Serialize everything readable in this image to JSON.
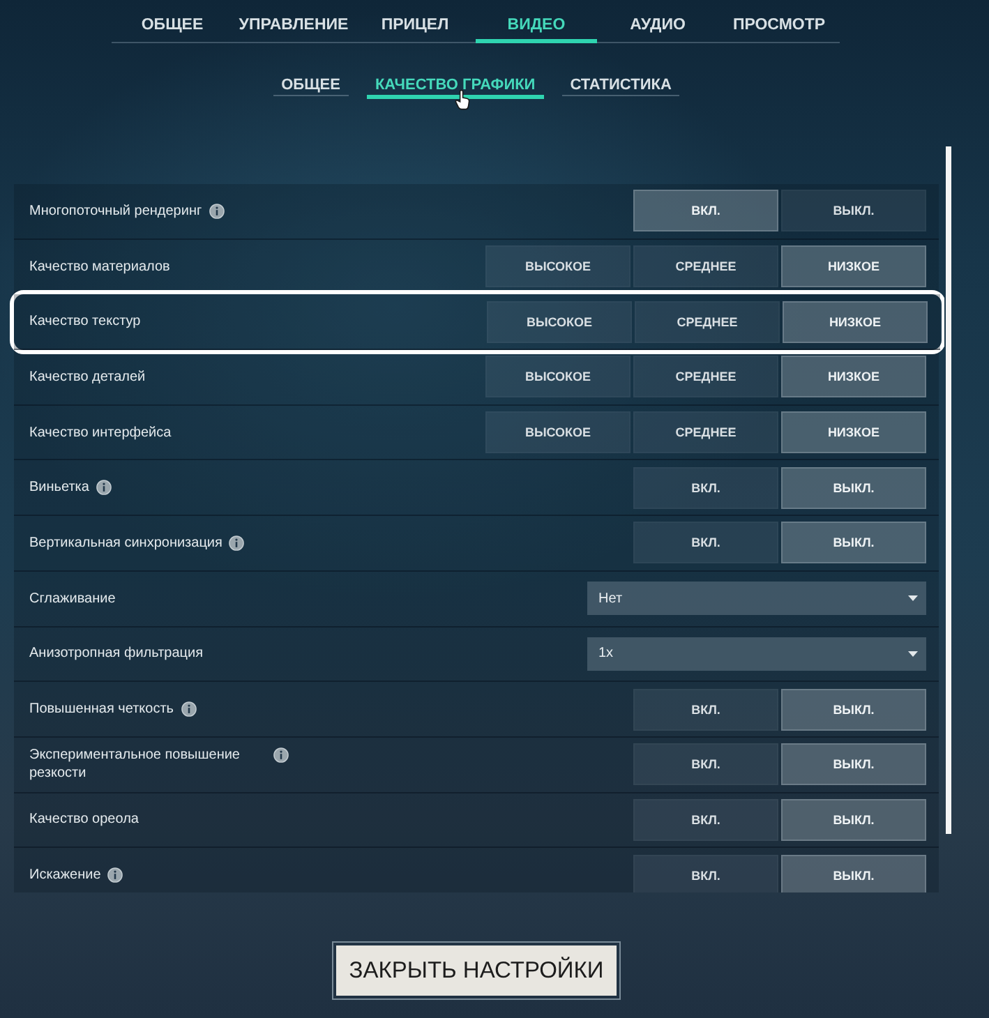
{
  "tabs": [
    {
      "label": "ОБЩЕЕ",
      "selected": false
    },
    {
      "label": "УПРАВЛЕНИЕ",
      "selected": false
    },
    {
      "label": "ПРИЦЕЛ",
      "selected": false
    },
    {
      "label": "ВИДЕО",
      "selected": true
    },
    {
      "label": "АУДИО",
      "selected": false
    },
    {
      "label": "ПРОСМОТР",
      "selected": false
    }
  ],
  "subtabs": [
    {
      "label": "ОБЩЕЕ",
      "selected": false
    },
    {
      "label": "КАЧЕСТВО ГРАФИКИ",
      "selected": true
    },
    {
      "label": "СТАТИСТИКА",
      "selected": false
    }
  ],
  "settings": [
    {
      "kind": "buttons",
      "label": "Многопоточный рендеринг",
      "info": true,
      "highlighted": false,
      "options": [
        {
          "label": "ВКЛ.",
          "selected": true
        },
        {
          "label": "ВЫКЛ.",
          "selected": false
        }
      ]
    },
    {
      "kind": "buttons",
      "label": "Качество материалов",
      "info": false,
      "highlighted": false,
      "options": [
        {
          "label": "ВЫСОКОЕ",
          "selected": false
        },
        {
          "label": "СРЕДНЕЕ",
          "selected": false
        },
        {
          "label": "НИЗКОЕ",
          "selected": true
        }
      ]
    },
    {
      "kind": "buttons",
      "label": "Качество текстур",
      "info": false,
      "highlighted": true,
      "options": [
        {
          "label": "ВЫСОКОЕ",
          "selected": false
        },
        {
          "label": "СРЕДНЕЕ",
          "selected": false
        },
        {
          "label": "НИЗКОЕ",
          "selected": true
        }
      ]
    },
    {
      "kind": "buttons",
      "label": "Качество деталей",
      "info": false,
      "highlighted": false,
      "options": [
        {
          "label": "ВЫСОКОЕ",
          "selected": false
        },
        {
          "label": "СРЕДНЕЕ",
          "selected": false
        },
        {
          "label": "НИЗКОЕ",
          "selected": true
        }
      ]
    },
    {
      "kind": "buttons",
      "label": "Качество интерфейса",
      "info": false,
      "highlighted": false,
      "options": [
        {
          "label": "ВЫСОКОЕ",
          "selected": false
        },
        {
          "label": "СРЕДНЕЕ",
          "selected": false
        },
        {
          "label": "НИЗКОЕ",
          "selected": true
        }
      ]
    },
    {
      "kind": "buttons",
      "label": "Виньетка",
      "info": true,
      "highlighted": false,
      "options": [
        {
          "label": "ВКЛ.",
          "selected": false
        },
        {
          "label": "ВЫКЛ.",
          "selected": true
        }
      ]
    },
    {
      "kind": "buttons",
      "label": "Вертикальная синхронизация",
      "info": true,
      "highlighted": false,
      "options": [
        {
          "label": "ВКЛ.",
          "selected": false
        },
        {
          "label": "ВЫКЛ.",
          "selected": true
        }
      ]
    },
    {
      "kind": "dropdown",
      "label": "Сглаживание",
      "info": false,
      "highlighted": false,
      "value": "Нет"
    },
    {
      "kind": "dropdown",
      "label": "Анизотропная фильтрация",
      "info": false,
      "highlighted": false,
      "value": "1x"
    },
    {
      "kind": "buttons",
      "label": "Повышенная четкость",
      "info": true,
      "highlighted": false,
      "options": [
        {
          "label": "ВКЛ.",
          "selected": false
        },
        {
          "label": "ВЫКЛ.",
          "selected": true
        }
      ]
    },
    {
      "kind": "buttons",
      "label": "Экспериментальное повышение резкости",
      "info": true,
      "highlighted": false,
      "options": [
        {
          "label": "ВКЛ.",
          "selected": false
        },
        {
          "label": "ВЫКЛ.",
          "selected": true
        }
      ]
    },
    {
      "kind": "buttons",
      "label": "Качество ореола",
      "info": false,
      "highlighted": false,
      "options": [
        {
          "label": "ВКЛ.",
          "selected": false
        },
        {
          "label": "ВЫКЛ.",
          "selected": true
        }
      ]
    },
    {
      "kind": "buttons",
      "label": "Искажение",
      "info": true,
      "highlighted": false,
      "options": [
        {
          "label": "ВКЛ.",
          "selected": false
        },
        {
          "label": "ВЫКЛ.",
          "selected": true
        }
      ]
    }
  ],
  "close_button": {
    "label": "ЗАКРЫТЬ НАСТРОЙКИ"
  }
}
